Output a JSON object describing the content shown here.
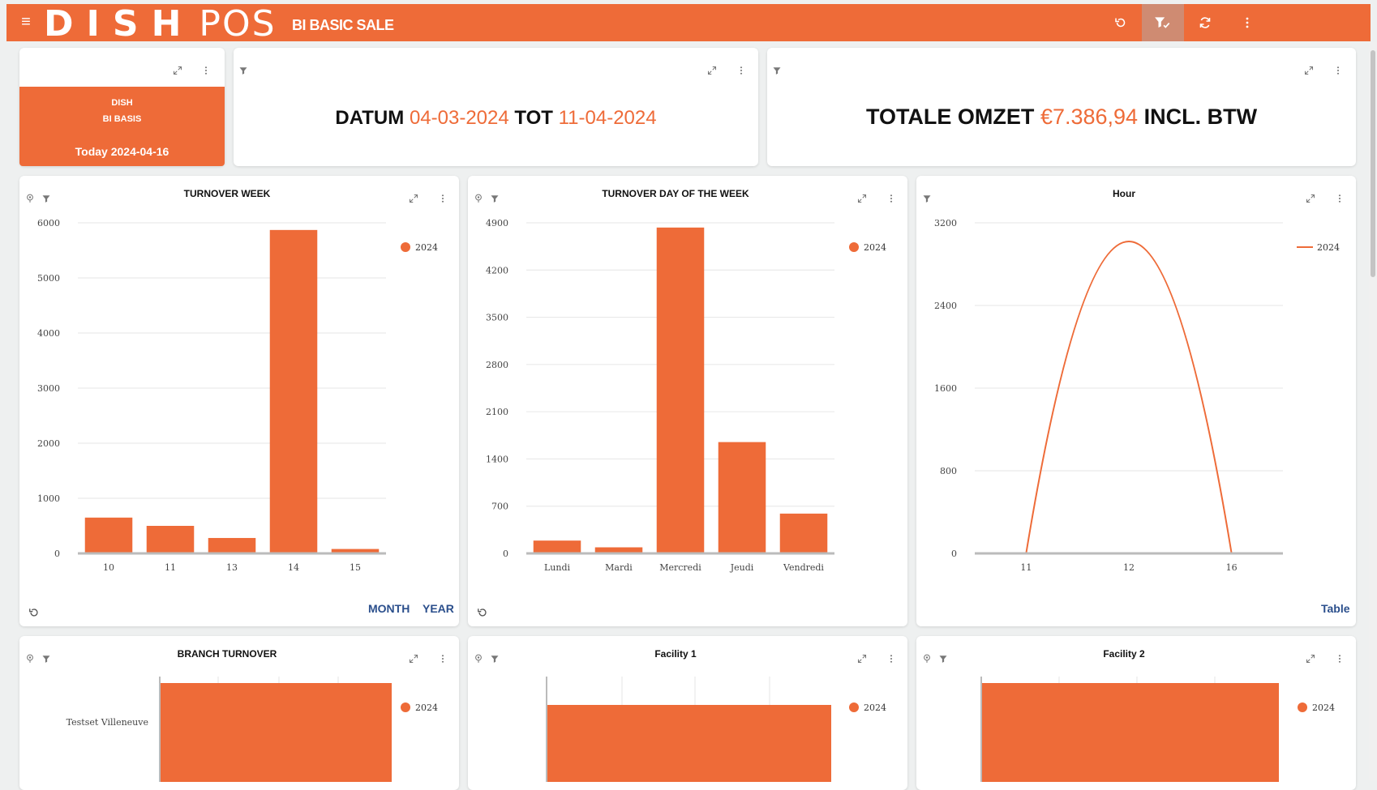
{
  "header": {
    "logo_dish": "DISH",
    "logo_pos": "POS",
    "subtitle": "BI BASIC SALE"
  },
  "badge": {
    "line1": "DISH",
    "line2": "BI BASIS",
    "today": "Today 2024-04-16"
  },
  "date_range": {
    "label": "DATUM",
    "from": "04-03-2024",
    "sep": "TOT",
    "to": "11-04-2024"
  },
  "total": {
    "label": "TOTALE OMZET",
    "value": "€7.386,94",
    "suffix": "INCL. BTW"
  },
  "accent_color": "#ee6b38",
  "link_color": "#2b4f8c",
  "cards": {
    "week": {
      "title": "TURNOVER WEEK",
      "legend": "2024",
      "link_month": "MONTH",
      "link_year": "YEAR"
    },
    "dow": {
      "title": "TURNOVER DAY OF THE WEEK",
      "legend": "2024"
    },
    "hour": {
      "title": "Hour",
      "legend": "2024",
      "link_table": "Table"
    },
    "branch": {
      "title": "BRANCH TURNOVER",
      "legend": "2024"
    },
    "fac1": {
      "title": "Facility 1",
      "legend": "2024"
    },
    "fac2": {
      "title": "Facility 2",
      "legend": "2024"
    }
  },
  "chart_data": [
    {
      "id": "week",
      "type": "bar",
      "title": "TURNOVER WEEK",
      "categories": [
        "10",
        "11",
        "13",
        "14",
        "15"
      ],
      "series": [
        {
          "name": "2024",
          "values": [
            650,
            500,
            280,
            5870,
            80
          ]
        }
      ],
      "yticks": [
        0,
        1000,
        2000,
        3000,
        4000,
        5000,
        6000
      ],
      "ylim": [
        0,
        6000
      ],
      "legend": "right",
      "grid": true
    },
    {
      "id": "dow",
      "type": "bar",
      "title": "TURNOVER DAY OF THE WEEK",
      "categories": [
        "Lundi",
        "Mardi",
        "Mercredi",
        "Jeudi",
        "Vendredi"
      ],
      "series": [
        {
          "name": "2024",
          "values": [
            190,
            90,
            4830,
            1650,
            590
          ]
        }
      ],
      "yticks": [
        0,
        700,
        1400,
        2100,
        2800,
        3500,
        4200,
        4900
      ],
      "ylim": [
        0,
        4900
      ],
      "legend": "right",
      "grid": true
    },
    {
      "id": "hour",
      "type": "line",
      "title": "Hour",
      "categories": [
        "11",
        "12",
        "16"
      ],
      "series": [
        {
          "name": "2024",
          "values": [
            0,
            3020,
            0
          ]
        }
      ],
      "yticks": [
        0,
        800,
        1600,
        2400,
        3200
      ],
      "ylim": [
        0,
        3200
      ],
      "legend": "right",
      "grid": true
    },
    {
      "id": "branch",
      "type": "bar",
      "orientation": "horizontal",
      "title": "BRANCH TURNOVER",
      "categories": [
        "Testset Villeneuve"
      ],
      "series": [
        {
          "name": "2024"
        }
      ],
      "legend": "right",
      "grid": true
    },
    {
      "id": "fac1",
      "type": "bar",
      "orientation": "horizontal",
      "title": "Facility 1",
      "series": [
        {
          "name": "2024"
        }
      ],
      "legend": "right",
      "grid": true
    },
    {
      "id": "fac2",
      "type": "bar",
      "orientation": "horizontal",
      "title": "Facility 2",
      "series": [
        {
          "name": "2024"
        }
      ],
      "legend": "right",
      "grid": true
    }
  ]
}
